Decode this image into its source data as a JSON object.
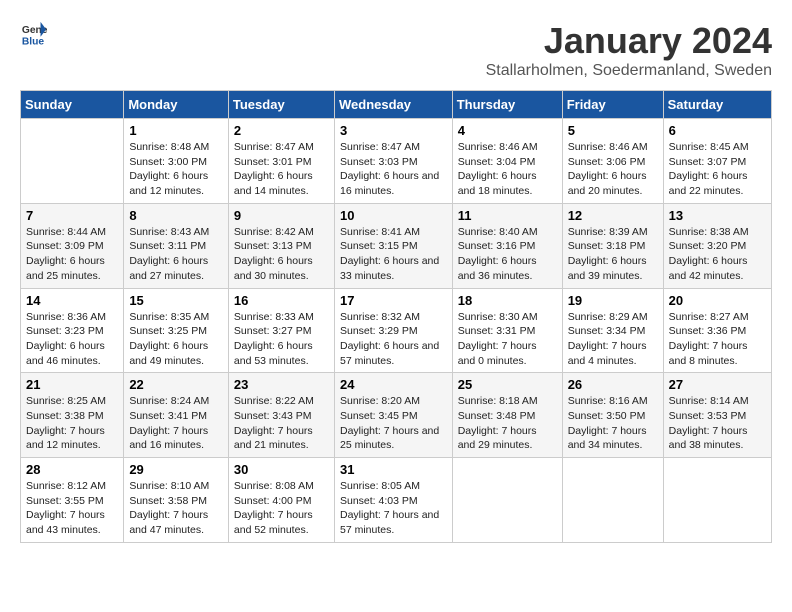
{
  "logo": {
    "line1": "General",
    "line2": "Blue"
  },
  "title": "January 2024",
  "subtitle": "Stallarholmen, Soedermanland, Sweden",
  "headers": [
    "Sunday",
    "Monday",
    "Tuesday",
    "Wednesday",
    "Thursday",
    "Friday",
    "Saturday"
  ],
  "weeks": [
    [
      {
        "day": "",
        "sunrise": "",
        "sunset": "",
        "daylight": ""
      },
      {
        "day": "1",
        "sunrise": "Sunrise: 8:48 AM",
        "sunset": "Sunset: 3:00 PM",
        "daylight": "Daylight: 6 hours and 12 minutes."
      },
      {
        "day": "2",
        "sunrise": "Sunrise: 8:47 AM",
        "sunset": "Sunset: 3:01 PM",
        "daylight": "Daylight: 6 hours and 14 minutes."
      },
      {
        "day": "3",
        "sunrise": "Sunrise: 8:47 AM",
        "sunset": "Sunset: 3:03 PM",
        "daylight": "Daylight: 6 hours and 16 minutes."
      },
      {
        "day": "4",
        "sunrise": "Sunrise: 8:46 AM",
        "sunset": "Sunset: 3:04 PM",
        "daylight": "Daylight: 6 hours and 18 minutes."
      },
      {
        "day": "5",
        "sunrise": "Sunrise: 8:46 AM",
        "sunset": "Sunset: 3:06 PM",
        "daylight": "Daylight: 6 hours and 20 minutes."
      },
      {
        "day": "6",
        "sunrise": "Sunrise: 8:45 AM",
        "sunset": "Sunset: 3:07 PM",
        "daylight": "Daylight: 6 hours and 22 minutes."
      }
    ],
    [
      {
        "day": "7",
        "sunrise": "Sunrise: 8:44 AM",
        "sunset": "Sunset: 3:09 PM",
        "daylight": "Daylight: 6 hours and 25 minutes."
      },
      {
        "day": "8",
        "sunrise": "Sunrise: 8:43 AM",
        "sunset": "Sunset: 3:11 PM",
        "daylight": "Daylight: 6 hours and 27 minutes."
      },
      {
        "day": "9",
        "sunrise": "Sunrise: 8:42 AM",
        "sunset": "Sunset: 3:13 PM",
        "daylight": "Daylight: 6 hours and 30 minutes."
      },
      {
        "day": "10",
        "sunrise": "Sunrise: 8:41 AM",
        "sunset": "Sunset: 3:15 PM",
        "daylight": "Daylight: 6 hours and 33 minutes."
      },
      {
        "day": "11",
        "sunrise": "Sunrise: 8:40 AM",
        "sunset": "Sunset: 3:16 PM",
        "daylight": "Daylight: 6 hours and 36 minutes."
      },
      {
        "day": "12",
        "sunrise": "Sunrise: 8:39 AM",
        "sunset": "Sunset: 3:18 PM",
        "daylight": "Daylight: 6 hours and 39 minutes."
      },
      {
        "day": "13",
        "sunrise": "Sunrise: 8:38 AM",
        "sunset": "Sunset: 3:20 PM",
        "daylight": "Daylight: 6 hours and 42 minutes."
      }
    ],
    [
      {
        "day": "14",
        "sunrise": "Sunrise: 8:36 AM",
        "sunset": "Sunset: 3:23 PM",
        "daylight": "Daylight: 6 hours and 46 minutes."
      },
      {
        "day": "15",
        "sunrise": "Sunrise: 8:35 AM",
        "sunset": "Sunset: 3:25 PM",
        "daylight": "Daylight: 6 hours and 49 minutes."
      },
      {
        "day": "16",
        "sunrise": "Sunrise: 8:33 AM",
        "sunset": "Sunset: 3:27 PM",
        "daylight": "Daylight: 6 hours and 53 minutes."
      },
      {
        "day": "17",
        "sunrise": "Sunrise: 8:32 AM",
        "sunset": "Sunset: 3:29 PM",
        "daylight": "Daylight: 6 hours and 57 minutes."
      },
      {
        "day": "18",
        "sunrise": "Sunrise: 8:30 AM",
        "sunset": "Sunset: 3:31 PM",
        "daylight": "Daylight: 7 hours and 0 minutes."
      },
      {
        "day": "19",
        "sunrise": "Sunrise: 8:29 AM",
        "sunset": "Sunset: 3:34 PM",
        "daylight": "Daylight: 7 hours and 4 minutes."
      },
      {
        "day": "20",
        "sunrise": "Sunrise: 8:27 AM",
        "sunset": "Sunset: 3:36 PM",
        "daylight": "Daylight: 7 hours and 8 minutes."
      }
    ],
    [
      {
        "day": "21",
        "sunrise": "Sunrise: 8:25 AM",
        "sunset": "Sunset: 3:38 PM",
        "daylight": "Daylight: 7 hours and 12 minutes."
      },
      {
        "day": "22",
        "sunrise": "Sunrise: 8:24 AM",
        "sunset": "Sunset: 3:41 PM",
        "daylight": "Daylight: 7 hours and 16 minutes."
      },
      {
        "day": "23",
        "sunrise": "Sunrise: 8:22 AM",
        "sunset": "Sunset: 3:43 PM",
        "daylight": "Daylight: 7 hours and 21 minutes."
      },
      {
        "day": "24",
        "sunrise": "Sunrise: 8:20 AM",
        "sunset": "Sunset: 3:45 PM",
        "daylight": "Daylight: 7 hours and 25 minutes."
      },
      {
        "day": "25",
        "sunrise": "Sunrise: 8:18 AM",
        "sunset": "Sunset: 3:48 PM",
        "daylight": "Daylight: 7 hours and 29 minutes."
      },
      {
        "day": "26",
        "sunrise": "Sunrise: 8:16 AM",
        "sunset": "Sunset: 3:50 PM",
        "daylight": "Daylight: 7 hours and 34 minutes."
      },
      {
        "day": "27",
        "sunrise": "Sunrise: 8:14 AM",
        "sunset": "Sunset: 3:53 PM",
        "daylight": "Daylight: 7 hours and 38 minutes."
      }
    ],
    [
      {
        "day": "28",
        "sunrise": "Sunrise: 8:12 AM",
        "sunset": "Sunset: 3:55 PM",
        "daylight": "Daylight: 7 hours and 43 minutes."
      },
      {
        "day": "29",
        "sunrise": "Sunrise: 8:10 AM",
        "sunset": "Sunset: 3:58 PM",
        "daylight": "Daylight: 7 hours and 47 minutes."
      },
      {
        "day": "30",
        "sunrise": "Sunrise: 8:08 AM",
        "sunset": "Sunset: 4:00 PM",
        "daylight": "Daylight: 7 hours and 52 minutes."
      },
      {
        "day": "31",
        "sunrise": "Sunrise: 8:05 AM",
        "sunset": "Sunset: 4:03 PM",
        "daylight": "Daylight: 7 hours and 57 minutes."
      },
      {
        "day": "",
        "sunrise": "",
        "sunset": "",
        "daylight": ""
      },
      {
        "day": "",
        "sunrise": "",
        "sunset": "",
        "daylight": ""
      },
      {
        "day": "",
        "sunrise": "",
        "sunset": "",
        "daylight": ""
      }
    ]
  ]
}
